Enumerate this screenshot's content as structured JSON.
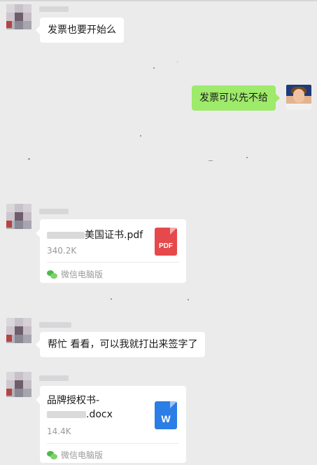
{
  "messages": [
    {
      "type": "text",
      "from": "contact",
      "text": "发票也要开始么"
    },
    {
      "type": "text",
      "from": "me",
      "text": "发票可以先不给"
    },
    {
      "type": "file",
      "from": "contact",
      "file_name_suffix": "美国证书.pdf",
      "file_size": "340.2K",
      "icon": "pdf-file-icon",
      "icon_label": "PDF",
      "source": "微信电脑版"
    },
    {
      "type": "text",
      "from": "contact",
      "text": "帮忙 看看，可以我就打出来签字了"
    },
    {
      "type": "file",
      "from": "contact",
      "file_name_line1": "品牌授权书-",
      "file_name_line2_suffix": ".docx",
      "file_size": "14.4K",
      "icon": "word-file-icon",
      "icon_label": "W",
      "source": "微信电脑版"
    }
  ],
  "colors": {
    "background": "#ebebeb",
    "bubble_mine": "#9eea6a",
    "bubble_contact": "#ffffff",
    "pdf": "#e5494b",
    "word": "#2a7ee6",
    "wechat": "#48bb49"
  }
}
